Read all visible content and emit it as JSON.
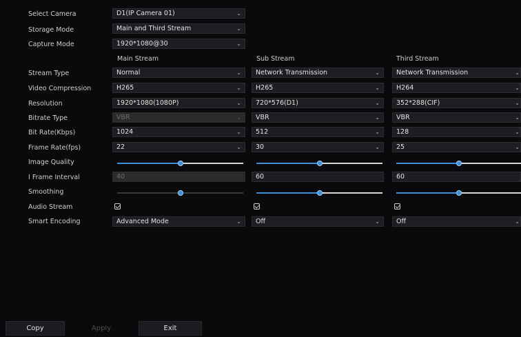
{
  "rows": {
    "select_camera": "Select Camera",
    "storage_mode": "Storage Mode",
    "capture_mode": "Capture Mode",
    "stream_type": "Stream Type",
    "video_compression": "Video Compression",
    "resolution": "Resolution",
    "bitrate_type": "Bitrate Type",
    "bit_rate": "Bit Rate(Kbps)",
    "frame_rate": "Frame Rate(fps)",
    "image_quality": "Image Quality",
    "i_frame_interval": "I Frame Interval",
    "smoothing": "Smoothing",
    "audio_stream": "Audio Stream",
    "smart_encoding": "Smart Encoding"
  },
  "top": {
    "camera": "D1(IP Camera 01)",
    "storage_mode": "Main and Third Stream",
    "capture_mode": "1920*1080@30"
  },
  "columns": {
    "main": {
      "header": "Main Stream",
      "stream_type": "Normal",
      "video_compression": "H265",
      "resolution": "1920*1080(1080P)",
      "bitrate_type": "VBR",
      "bit_rate": "1024",
      "frame_rate": "22",
      "image_quality_level": 0.5,
      "i_frame_interval": "40",
      "smoothing_level": 0.5,
      "audio_stream": true,
      "smart_encoding": "Advanced Mode"
    },
    "sub": {
      "header": "Sub Stream",
      "stream_type": "Network Transmission",
      "video_compression": "H265",
      "resolution": "720*576(D1)",
      "bitrate_type": "VBR",
      "bit_rate": "512",
      "frame_rate": "30",
      "image_quality_level": 0.5,
      "i_frame_interval": "60",
      "smoothing_level": 0.5,
      "audio_stream": true,
      "smart_encoding": "Off"
    },
    "third": {
      "header": "Third Stream",
      "stream_type": "Network Transmission",
      "video_compression": "H264",
      "resolution": "352*288(CIF)",
      "bitrate_type": "VBR",
      "bit_rate": "128",
      "frame_rate": "25",
      "image_quality_level": 0.5,
      "i_frame_interval": "60",
      "smoothing_level": 0.5,
      "audio_stream": true,
      "smart_encoding": "Off"
    }
  },
  "buttons": {
    "copy": "Copy",
    "apply": "Apply",
    "exit": "Exit"
  },
  "colors": {
    "accent": "#3f8fd8",
    "background": "#0a0a0c",
    "field": "#1e1e22"
  },
  "icons": {
    "dropdown": "chevron-down-icon",
    "checkbox": "checkbox-checked-icon"
  }
}
